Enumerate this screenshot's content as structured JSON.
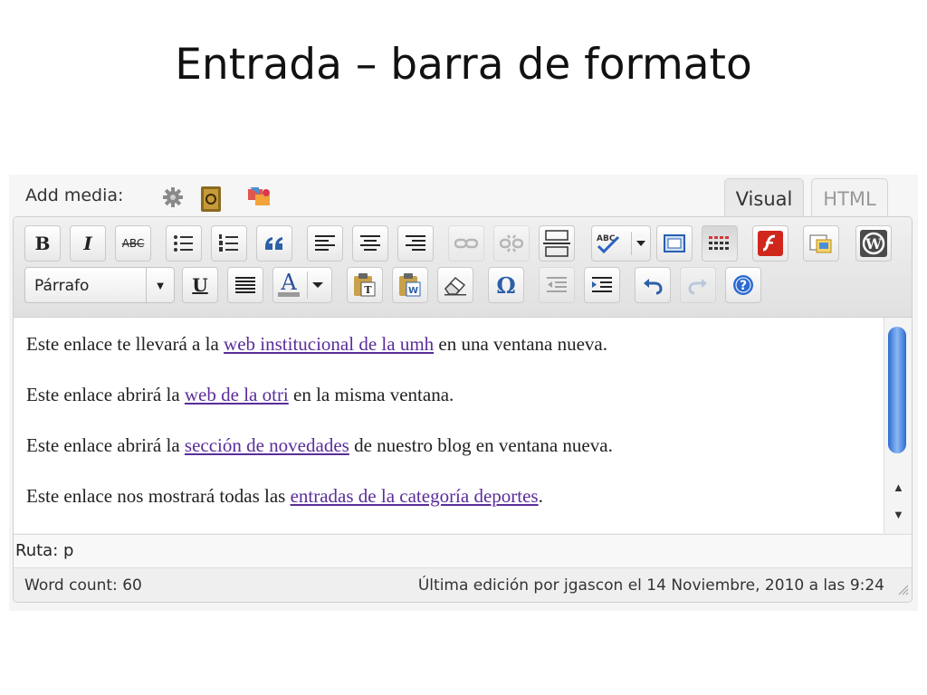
{
  "slide": {
    "title": "Entrada – barra de formato"
  },
  "media": {
    "label": "Add media:",
    "icons": [
      "gear-icon",
      "address-book-icon",
      "media-stack-icon"
    ]
  },
  "tabs": {
    "visual": "Visual",
    "html": "HTML"
  },
  "toolbar": {
    "bold": "B",
    "italic": "I",
    "strike": "ABC",
    "underline": "U",
    "charmap": "Ω",
    "format_select": "Párrafo",
    "icons": [
      "bold-icon",
      "italic-icon",
      "strikethrough-icon",
      "bullet-list-icon",
      "numbered-list-icon",
      "blockquote-icon",
      "align-left-icon",
      "align-center-icon",
      "align-right-icon",
      "link-icon",
      "unlink-icon",
      "more-tag-icon",
      "spellcheck-icon",
      "fullscreen-icon",
      "kitchen-sink-icon",
      "flash-icon",
      "insert-media-icon",
      "wordpress-icon",
      "underline-icon",
      "justify-icon",
      "text-color-icon",
      "paste-text-icon",
      "paste-word-icon",
      "eraser-icon",
      "omega-icon",
      "outdent-icon",
      "indent-icon",
      "undo-icon",
      "redo-icon",
      "help-icon"
    ]
  },
  "content": {
    "paragraphs": [
      {
        "before": "Este enlace te llevará a la ",
        "link": "web institucional de la umh",
        "after": " en una ventana nueva."
      },
      {
        "before": "Este enlace abrirá la ",
        "link": "web de la otri",
        "after": " en la misma ventana."
      },
      {
        "before": "Este enlace abrirá la ",
        "link": "sección de novedades",
        "after": " de nuestro blog en ventana nueva."
      },
      {
        "before": "Este enlace nos mostrará todas las ",
        "link": "entradas de la categoría deportes",
        "after": "."
      }
    ]
  },
  "path": {
    "label": "Ruta: p"
  },
  "footer": {
    "word_count": "Word count: 60",
    "last_edit": "Última edición por jgascon el 14 Noviembre, 2010 a las 9:24"
  },
  "colors": {
    "link": "#5a2d9a",
    "scrollbar": "#2e6bd1",
    "flash": "#d0271d"
  }
}
